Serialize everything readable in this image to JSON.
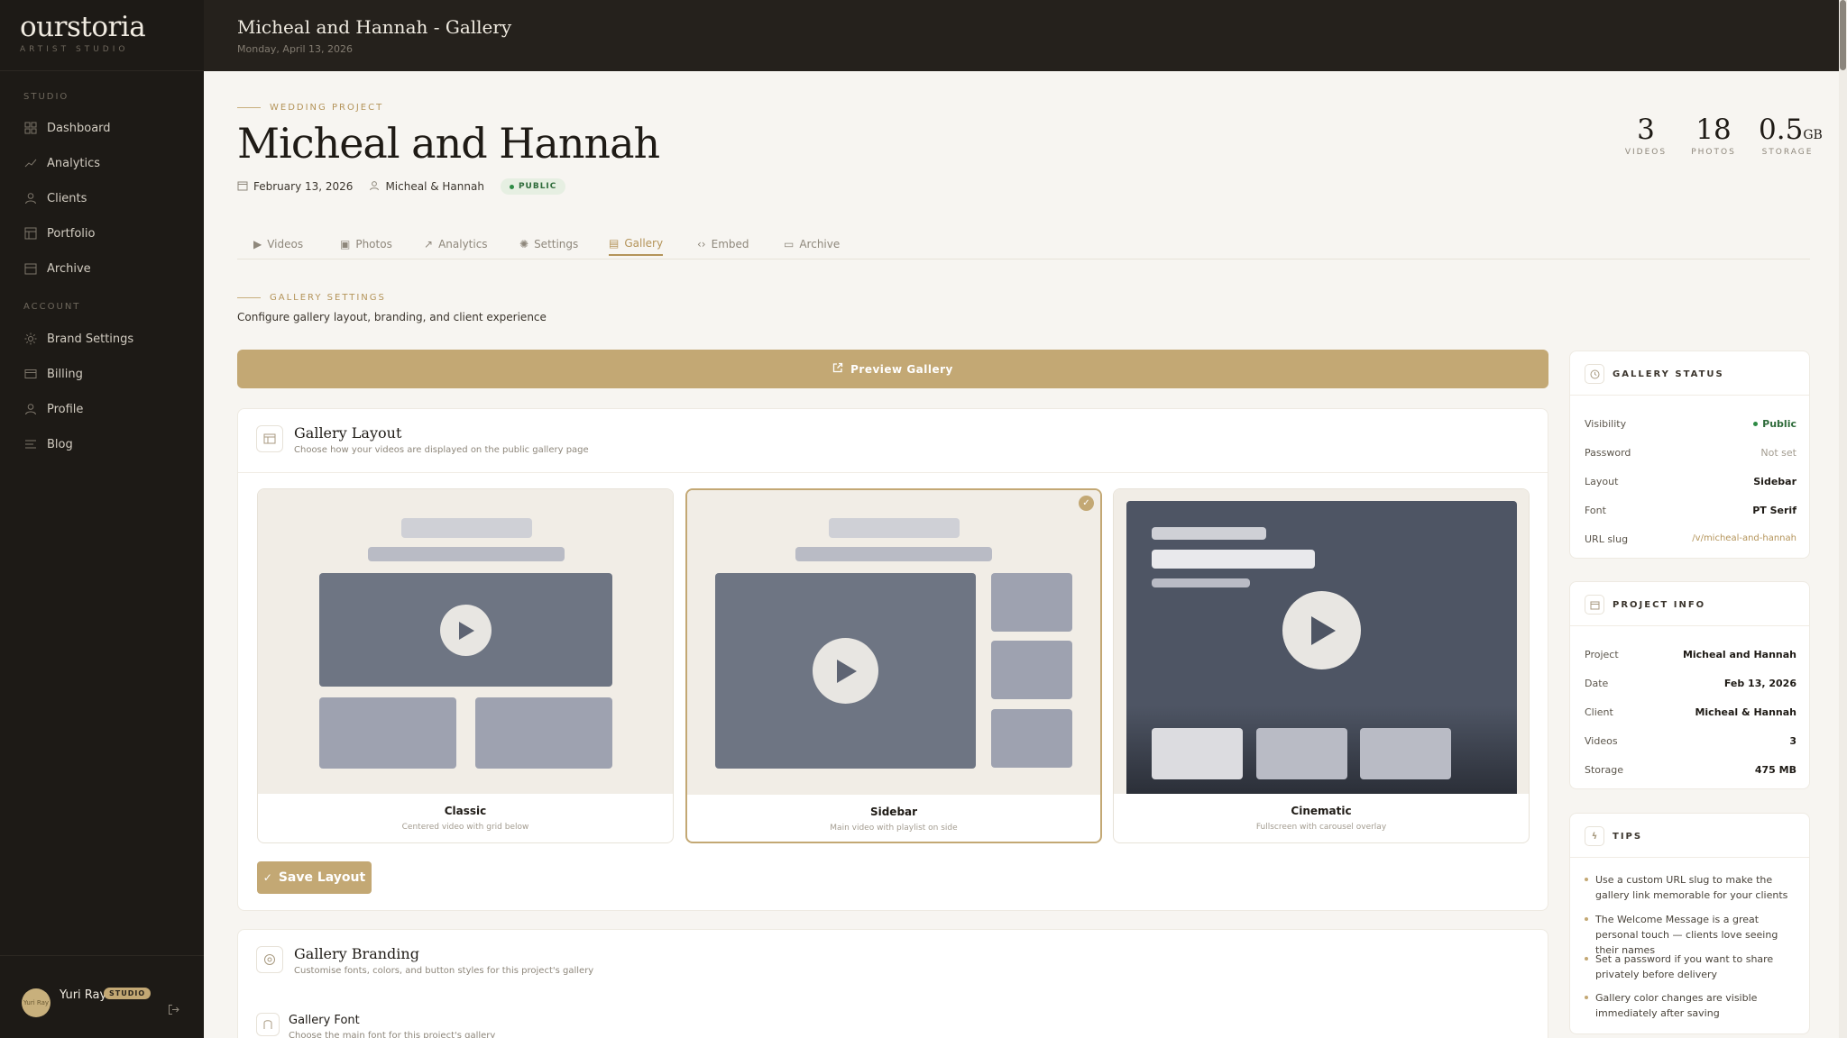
{
  "app": {
    "logo": "ourstoria",
    "logo_sub": "ARTIST STUDIO"
  },
  "sidebar": {
    "section_studio": "STUDIO",
    "section_account": "ACCOUNT",
    "items": [
      {
        "label": "Dashboard",
        "icon": "grid-icon"
      },
      {
        "label": "Analytics",
        "icon": "chart-icon"
      },
      {
        "label": "Clients",
        "icon": "user-icon"
      },
      {
        "label": "Portfolio",
        "icon": "portfolio-icon"
      },
      {
        "label": "Archive",
        "icon": "archive-icon"
      },
      {
        "label": "Brand Settings",
        "icon": "sun-icon"
      },
      {
        "label": "Billing",
        "icon": "card-icon"
      },
      {
        "label": "Profile",
        "icon": "user-icon"
      },
      {
        "label": "Blog",
        "icon": "lines-icon"
      }
    ],
    "user": {
      "name": "Yuri Ray",
      "badge": "STUDIO",
      "avatar_text": "Yuri Ray"
    }
  },
  "topbar": {
    "title": "Micheal and Hannah - Gallery",
    "date": "Monday, April 13, 2026"
  },
  "project": {
    "eyebrow": "WEDDING PROJECT",
    "title": "Micheal and Hannah",
    "date": "February 13, 2026",
    "client": "Micheal & Hannah",
    "visibility_pill": "PUBLIC",
    "stats": [
      {
        "value": "3",
        "unit": "",
        "label": "VIDEOS"
      },
      {
        "value": "18",
        "unit": "",
        "label": "PHOTOS"
      },
      {
        "value": "0.5",
        "unit": "GB",
        "label": "STORAGE"
      }
    ]
  },
  "tabs": [
    {
      "label": "Videos",
      "icon": "▶"
    },
    {
      "label": "Photos",
      "icon": "▣"
    },
    {
      "label": "Analytics",
      "icon": "↗"
    },
    {
      "label": "Settings",
      "icon": "✺"
    },
    {
      "label": "Gallery",
      "icon": "▤"
    },
    {
      "label": "Embed",
      "icon": "‹›"
    },
    {
      "label": "Archive",
      "icon": "▭"
    }
  ],
  "gallery_settings": {
    "eyebrow": "GALLERY SETTINGS",
    "description": "Configure gallery layout, branding, and client experience",
    "preview_button": "Preview Gallery"
  },
  "layout_card": {
    "title": "Gallery Layout",
    "subtitle": "Choose how your videos are displayed on the public gallery page",
    "options": [
      {
        "name": "Classic",
        "desc": "Centered video with grid below",
        "selected": false
      },
      {
        "name": "Sidebar",
        "desc": "Main video with playlist on side",
        "selected": true
      },
      {
        "name": "Cinematic",
        "desc": "Fullscreen with carousel overlay",
        "selected": false
      }
    ],
    "save_button": "Save Layout"
  },
  "branding_card": {
    "title": "Gallery Branding",
    "subtitle": "Customise fonts, colors, and button styles for this project's gallery",
    "font_label": "Gallery Font",
    "font_desc": "Choose the main font for this project's gallery"
  },
  "gallery_status": {
    "title": "GALLERY STATUS",
    "rows": [
      {
        "k": "Visibility",
        "v": "Public"
      },
      {
        "k": "Password",
        "v": "Not set"
      },
      {
        "k": "Layout",
        "v": "Sidebar"
      },
      {
        "k": "Font",
        "v": "PT Serif"
      },
      {
        "k": "URL slug",
        "v": "/v/micheal-and-hannah"
      }
    ]
  },
  "project_info": {
    "title": "PROJECT INFO",
    "rows": [
      {
        "k": "Project",
        "v": "Micheal and Hannah"
      },
      {
        "k": "Date",
        "v": "Feb 13, 2026"
      },
      {
        "k": "Client",
        "v": "Micheal & Hannah"
      },
      {
        "k": "Videos",
        "v": "3"
      },
      {
        "k": "Storage",
        "v": "475 MB"
      }
    ]
  },
  "tips": {
    "title": "TIPS",
    "items": [
      "Use a custom URL slug to make the gallery link memorable for your clients",
      "The Welcome Message is a great personal touch — clients love seeing their names",
      "Set a password if you want to share privately before delivery",
      "Gallery color changes are visible immediately after saving"
    ]
  },
  "colors": {
    "accent_gold": "#c3a874",
    "sidebar_bg": "#1d1a16",
    "page_bg": "#f7f5f1",
    "status_green": "#2e8b45"
  }
}
